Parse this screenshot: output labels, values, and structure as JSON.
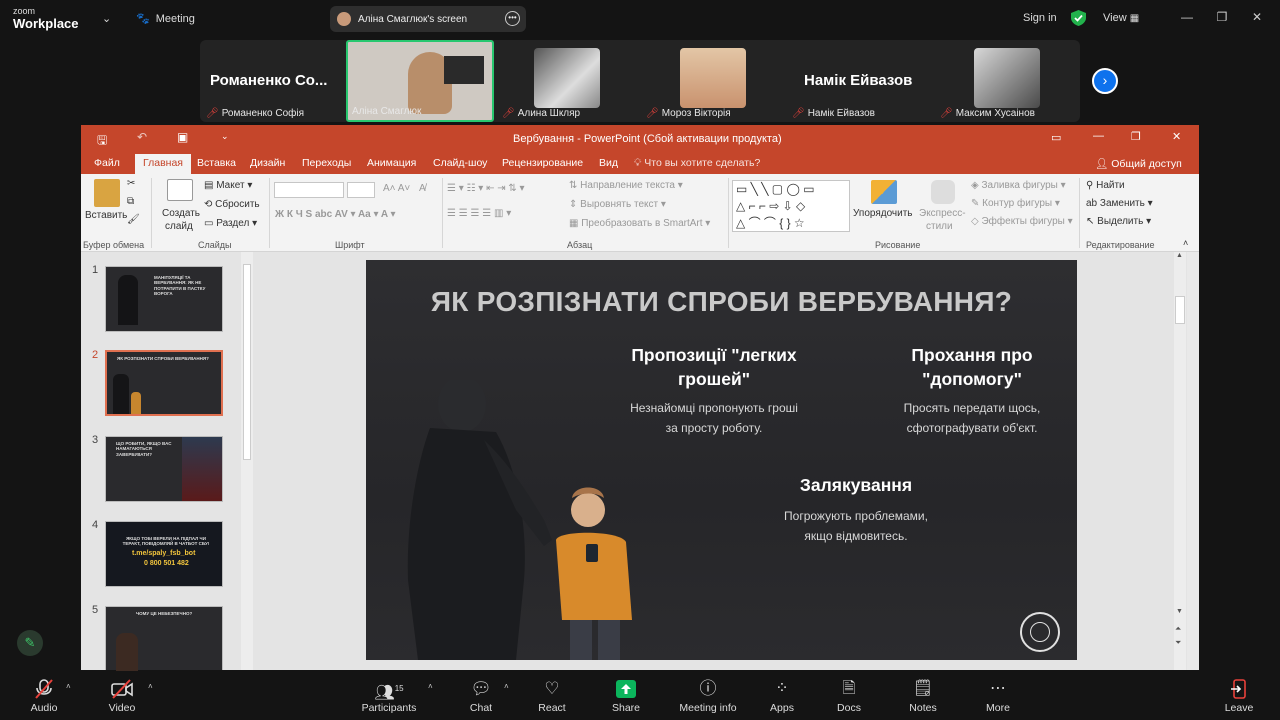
{
  "zoom": {
    "brand_small": "zoom",
    "brand_big": "Workplace",
    "meeting_label": "Meeting",
    "screen_share_label": "Аліна Смаглюк's screen",
    "sign_in": "Sign in",
    "view": "View"
  },
  "gallery": {
    "tiles": [
      {
        "big_name": "Романенко Со...",
        "name": "Романенко Софія"
      },
      {
        "name": "Аліна Смаглюк"
      },
      {
        "name": "Алина Шкляр"
      },
      {
        "name": "Мороз Вікторія"
      },
      {
        "big_name": "Намік Ейвазов",
        "name": "Намік Ейвазов"
      },
      {
        "name": "Максим Хусаінов"
      }
    ]
  },
  "ppt": {
    "title": "Вербування - PowerPoint (Сбой активации продукта)",
    "tabs": [
      "Файл",
      "Главная",
      "Вставка",
      "Дизайн",
      "Переходы",
      "Анимация",
      "Слайд-шоу",
      "Рецензирование",
      "Вид"
    ],
    "tell_me": "Что вы хотите сделать?",
    "share": "Общий доступ",
    "ribbon": {
      "paste": "Вставить",
      "new_slide_1": "Создать",
      "new_slide_2": "слайд",
      "layout": "Макет",
      "reset": "Сбросить",
      "section": "Раздел",
      "text_direction": "Направление текста",
      "align_text": "Выровнять текст",
      "smartart": "Преобразовать в SmartArt",
      "arrange": "Упорядочить",
      "styles_1": "Экспресс-",
      "styles_2": "стили",
      "fill": "Заливка фигуры",
      "outline": "Контур фигуры",
      "effects": "Эффекты фигуры",
      "find": "Найти",
      "replace": "Заменить",
      "select": "Выделить",
      "groups": [
        "Буфер обмена",
        "Слайды",
        "Шрифт",
        "Абзац",
        "Рисование",
        "Редактирование"
      ]
    },
    "slides_numbers": [
      "1",
      "2",
      "3",
      "4",
      "5"
    ],
    "thumb_texts": {
      "s1": "МАНІПУЛЯЦІЇ ТА ВЕРБУВАННЯ: ЯК НЕ ПОТРАПИТИ В ПАСТКУ ВОРОГА",
      "s2": "ЯК РОЗПІЗНАТИ СПРОБИ ВЕРБУВАННЯ?",
      "s3": "ЩО РОБИТИ, ЯКЩО ВАС НАМАГАЮТЬСЯ ЗАВЕРБУВАТИ?",
      "s4a": "ЯКЩО ТОБІ ВЕРЕЛИ НА ПІДПАЛ ЧИ ТЕРАКТ, ПОВІДОМЛЯЙ В ЧАТБОТ СБУ!",
      "s4b": "t.me/spaly_fsb_bot",
      "s4c": "0 800 501 482",
      "s5": "ЧОМУ ЦЕ НЕБЕЗПЕЧНО?"
    },
    "slide": {
      "title": "ЯК РОЗПІЗНАТИ СПРОБИ ВЕРБУВАННЯ?",
      "h1": "Пропозиції \"легких грошей\"",
      "d1": "Незнайомці пропонують гроші за просту роботу.",
      "h2": "Прохання про \"допомогу\"",
      "d2": "Просять передати щось, сфотографувати об'єкт.",
      "h3": "Залякування",
      "d3": "Погрожують проблемами, якщо відмовитесь."
    }
  },
  "toolbar": {
    "audio": "Audio",
    "video": "Video",
    "participants": "Participants",
    "participants_count": "15",
    "chat": "Chat",
    "react": "React",
    "share": "Share",
    "meeting_info": "Meeting info",
    "apps": "Apps",
    "docs": "Docs",
    "notes": "Notes",
    "more": "More",
    "leave": "Leave"
  },
  "colors": {
    "ppt_accent": "#c5462b",
    "zoom_blue": "#0e72ed",
    "share_green": "#0bb55c",
    "mute_red": "#e8413b",
    "active_speaker": "#28c76f"
  }
}
